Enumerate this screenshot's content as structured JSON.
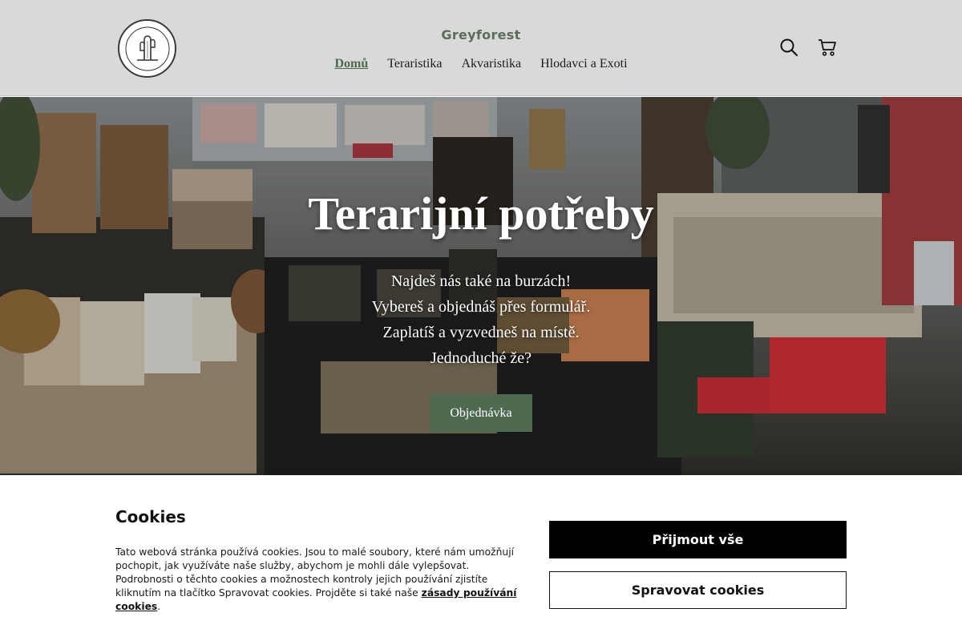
{
  "header": {
    "brand": "Greyforest",
    "logo_icon": "cactus-logo",
    "nav": [
      {
        "label": "Domů",
        "active": true
      },
      {
        "label": "Teraristika",
        "active": false
      },
      {
        "label": "Akvaristika",
        "active": false
      },
      {
        "label": "Hlodavci a Exoti",
        "active": false
      }
    ],
    "icons": [
      "search-icon",
      "cart-icon"
    ],
    "bg_color": "#d9d9d9",
    "accent_color": "#4c6a4d"
  },
  "hero": {
    "title": "Terarijní potřeby",
    "lines": [
      "Najdeš nás také na burzách!",
      "Vybereš a objednáš přes formulář.",
      "Zaplatíš a vyzvedneš na místě.",
      "Jednoduché že?"
    ],
    "button_label": "Objednávka",
    "button_color": "#4e6a50"
  },
  "cookies": {
    "title": "Cookies",
    "text": "Tato webová stránka používá cookies. Jsou to malé soubory, které nám umožňují pochopit, jak využíváte naše služby, abychom je mohli dále vylepšovat. Podrobnosti o těchto cookies a možnostech kontroly jejich používání zjistíte kliknutím na tlačítko Spravovat cookies. Projděte si také naše ",
    "link_label": "zásady používání cookies",
    "text_end": ".",
    "accept_label": "Přijmout vše",
    "manage_label": "Spravovat cookies"
  }
}
